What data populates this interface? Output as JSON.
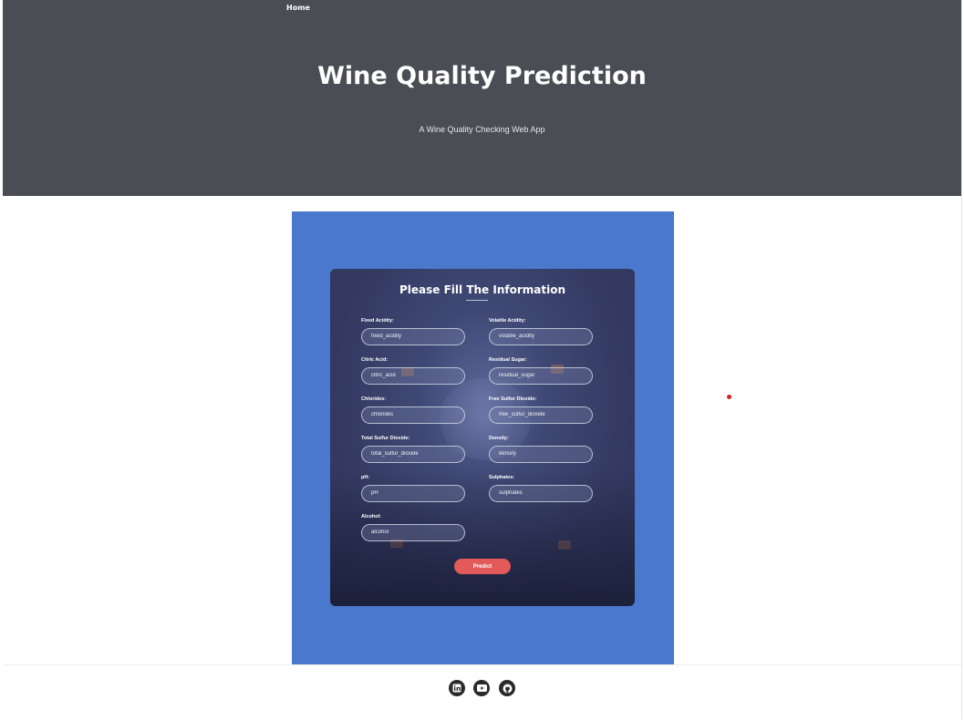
{
  "nav": {
    "home_label": "Home"
  },
  "hero": {
    "title": "Wine Quality Prediction",
    "subtitle": "A Wine Quality Checking Web App"
  },
  "form": {
    "title": "Please Fill The Information",
    "fields": [
      {
        "label": "Fixed Acidity:",
        "placeholder": "fixed_acidity"
      },
      {
        "label": "Volatile Acidity:",
        "placeholder": "volatile_acidity"
      },
      {
        "label": "Citric Acid:",
        "placeholder": "citric_acid"
      },
      {
        "label": "Residual Sugar:",
        "placeholder": "residual_sugar"
      },
      {
        "label": "Chlorides:",
        "placeholder": "chlorides"
      },
      {
        "label": "Free Sulfur Dioxide:",
        "placeholder": "free_sulfur_dioxide"
      },
      {
        "label": "Total Sulfur Dioxide:",
        "placeholder": "total_sulfur_dioxide"
      },
      {
        "label": "Density:",
        "placeholder": "density"
      },
      {
        "label": "pH:",
        "placeholder": "pH"
      },
      {
        "label": "Sulphates:",
        "placeholder": "sulphates"
      },
      {
        "label": "Alcohol:",
        "placeholder": "alcohol"
      }
    ],
    "submit_label": "Predict"
  },
  "footer": {
    "social": [
      {
        "icon": "linkedin-icon"
      },
      {
        "icon": "youtube-icon"
      },
      {
        "icon": "github-icon"
      }
    ]
  },
  "colors": {
    "header_bg": "#4a4d54",
    "panel_bg": "#4a78cc",
    "card_bg": "#343a62",
    "button_bg": "#e35a5a"
  }
}
